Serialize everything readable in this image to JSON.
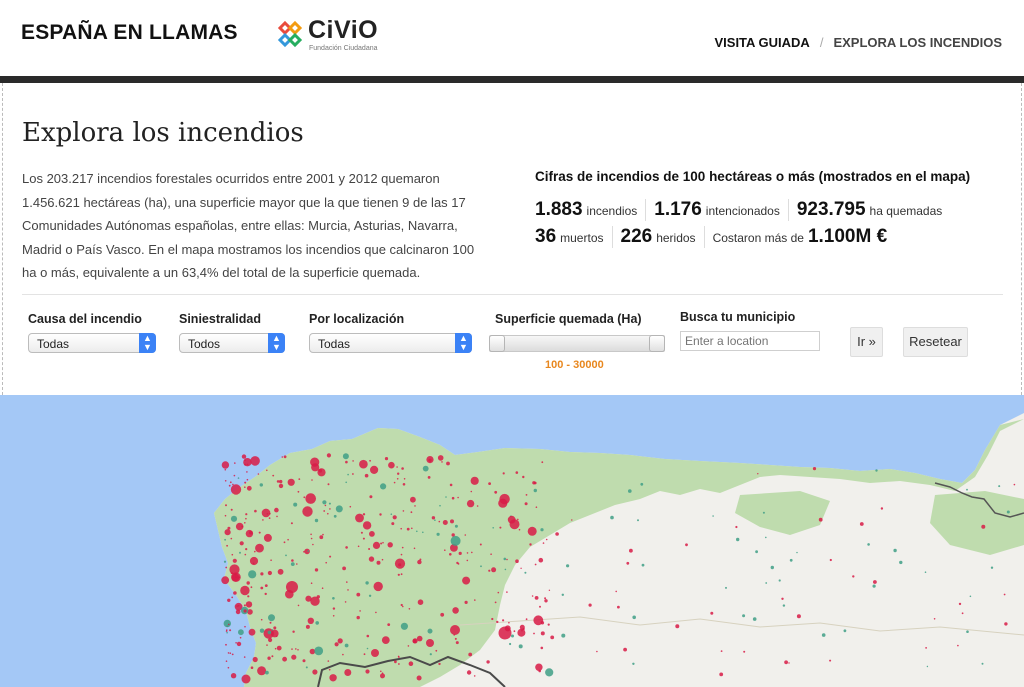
{
  "header": {
    "site_title": "ESPAÑA EN LLAMAS",
    "logo_text": "CiViO",
    "logo_tagline": "Fundación Ciudadana",
    "nav": {
      "tour": "VISITA GUIADA",
      "separator": "/",
      "explore": "EXPLORA LOS INCENDIOS"
    }
  },
  "main": {
    "title": "Explora los incendios",
    "intro": "Los 203.217 incendios forestales ocurridos entre 2001 y 2012 quemaron 1.456.621 hectáreas (ha), una superficie mayor que la que tienen 9 de las 17 Comunidades Autónomas españolas, entre ellas: Murcia, Asturias, Navarra, Madrid o País Vasco. En el mapa mostramos los incendios que calcinaron 100 ha o más, equivalente a un 63,4% del total de la superficie quemada."
  },
  "stats": {
    "title": "Cifras de incendios de 100 hectáreas o más (mostrados en el mapa)",
    "fires": {
      "value": "1.883",
      "label": "incendios"
    },
    "intentional": {
      "value": "1.176",
      "label": "intencionados"
    },
    "burned": {
      "value": "923.795",
      "label": "ha quemadas"
    },
    "deaths": {
      "value": "36",
      "label": "muertos"
    },
    "injured": {
      "value": "226",
      "label": "heridos"
    },
    "cost": {
      "prefix": "Costaron más de",
      "value": "1.100M €"
    }
  },
  "filters": {
    "cause": {
      "label": "Causa del incendio",
      "value": "Todas"
    },
    "accidents": {
      "label": "Siniestralidad",
      "value": "Todos"
    },
    "location": {
      "label": "Por localización",
      "value": "Todas"
    },
    "area": {
      "label": "Superficie quemada (Ha)",
      "range_text": "100 - 30000",
      "min": 100,
      "max": 30000
    },
    "search": {
      "label": "Busca tu municipio",
      "placeholder": "Enter a location"
    },
    "go_button": "Ir »",
    "reset_button": "Resetear"
  },
  "colors": {
    "accent_orange": "#e8871e",
    "select_blue": "#3b82f6",
    "sea": "#a4c8f6",
    "land": "#f1f0ec",
    "forest": "#bfdcae",
    "fire_dot": "#d81b46",
    "cause_dot_teal": "#3f9f86"
  },
  "icons": {
    "logo": "civio-knot-logo",
    "select_arrow": "updown-chevron-icon"
  }
}
